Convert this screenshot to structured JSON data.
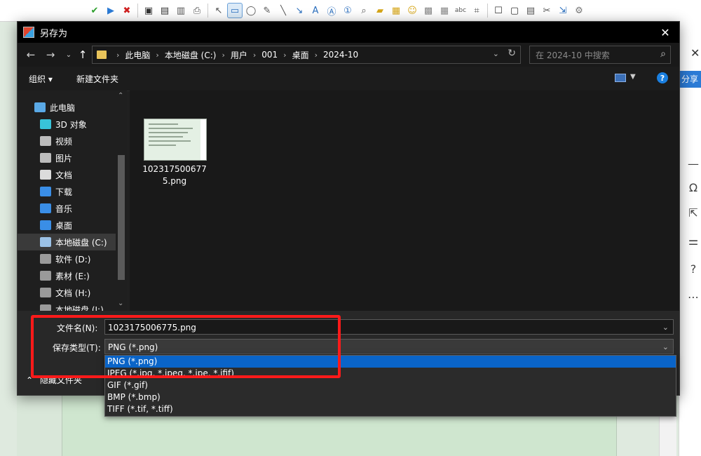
{
  "toolbar": {
    "tools": [
      {
        "icon": "check-icon",
        "glyph": "✔",
        "color": "#2da02d"
      },
      {
        "icon": "play-icon",
        "glyph": "▶",
        "color": "#2b7bd6"
      },
      {
        "icon": "close-x-icon",
        "glyph": "✖",
        "color": "#d02020"
      },
      {
        "icon": "save-icon",
        "glyph": "▣",
        "color": "#333333"
      },
      {
        "icon": "save-as-icon",
        "glyph": "▤",
        "color": "#333333"
      },
      {
        "icon": "clipboard-icon",
        "glyph": "▥",
        "color": "#555555"
      },
      {
        "icon": "print-icon",
        "glyph": "⎙",
        "color": "#555555"
      },
      {
        "icon": "pointer-icon",
        "glyph": "↖",
        "color": "#555555"
      },
      {
        "icon": "rectangle-icon",
        "glyph": "▭",
        "color": "#2b6fbe"
      },
      {
        "icon": "ellipse-icon",
        "glyph": "◯",
        "color": "#555555"
      },
      {
        "icon": "pen-icon",
        "glyph": "✎",
        "color": "#555555"
      },
      {
        "icon": "line-icon",
        "glyph": "╲",
        "color": "#555555"
      },
      {
        "icon": "arrow-icon",
        "glyph": "↘",
        "color": "#2b6fbe"
      },
      {
        "icon": "text-icon",
        "glyph": "A",
        "color": "#2b6fbe"
      },
      {
        "icon": "textbox-icon",
        "glyph": "Ⓐ",
        "color": "#2b6fbe"
      },
      {
        "icon": "counter-icon",
        "glyph": "①",
        "color": "#2b6fbe"
      },
      {
        "icon": "magnifier-icon",
        "glyph": "⌕",
        "color": "#555555"
      },
      {
        "icon": "highlighter-icon",
        "glyph": "▰",
        "color": "#d6a619"
      },
      {
        "icon": "image-icon",
        "glyph": "▦",
        "color": "#d6a619"
      },
      {
        "icon": "emoji-icon",
        "glyph": "☺",
        "color": "#d6a619"
      },
      {
        "icon": "blur-icon",
        "glyph": "▩",
        "color": "#888888"
      },
      {
        "icon": "pixelate-icon",
        "glyph": "▦",
        "color": "#888888"
      },
      {
        "icon": "spellcheck-icon",
        "glyph": "abc",
        "color": "#555555"
      },
      {
        "icon": "crop-icon",
        "glyph": "⌗",
        "color": "#555555"
      },
      {
        "icon": "border-icon",
        "glyph": "☐",
        "color": "#333333"
      },
      {
        "icon": "frame-icon",
        "glyph": "▢",
        "color": "#333333"
      },
      {
        "icon": "shadow-icon",
        "glyph": "▤",
        "color": "#555555"
      },
      {
        "icon": "tools-icon",
        "glyph": "✂",
        "color": "#555555"
      },
      {
        "icon": "export-icon",
        "glyph": "⇲",
        "color": "#2b6fbe"
      },
      {
        "icon": "settings-icon",
        "glyph": "⚙",
        "color": "#777777"
      }
    ]
  },
  "background_app": {
    "share_label": "分享"
  },
  "dialog": {
    "title": "另存为",
    "breadcrumbs": [
      "此电脑",
      "本地磁盘 (C:)",
      "用户",
      "001",
      "桌面",
      "2024-10"
    ],
    "search_placeholder": "在 2024-10 中搜索",
    "organize_label": "组织 ▾",
    "new_folder_label": "新建文件夹",
    "nav_items": [
      {
        "label": "此电脑",
        "icon": "computer-icon",
        "color": "#5aa9e6",
        "indent": 0
      },
      {
        "label": "3D 对象",
        "icon": "cube-icon",
        "color": "#38c3d8",
        "indent": 1
      },
      {
        "label": "视频",
        "icon": "video-icon",
        "color": "#bcbcbc",
        "indent": 1
      },
      {
        "label": "图片",
        "icon": "picture-icon",
        "color": "#bcbcbc",
        "indent": 1
      },
      {
        "label": "文档",
        "icon": "document-icon",
        "color": "#dcdcdc",
        "indent": 1
      },
      {
        "label": "下载",
        "icon": "download-icon",
        "color": "#3a8ee6",
        "indent": 1
      },
      {
        "label": "音乐",
        "icon": "music-icon",
        "color": "#3a8ee6",
        "indent": 1
      },
      {
        "label": "桌面",
        "icon": "desktop-icon",
        "color": "#3a8ee6",
        "indent": 1
      },
      {
        "label": "本地磁盘 (C:)",
        "icon": "drive-c-icon",
        "color": "#9bc1e6",
        "indent": 1,
        "selected": true
      },
      {
        "label": "软件 (D:)",
        "icon": "drive-icon",
        "color": "#9a9a9a",
        "indent": 1
      },
      {
        "label": "素材 (E:)",
        "icon": "drive-icon",
        "color": "#9a9a9a",
        "indent": 1
      },
      {
        "label": "文档 (H:)",
        "icon": "drive-icon",
        "color": "#9a9a9a",
        "indent": 1
      },
      {
        "label": "本地磁盘 (J:)",
        "icon": "drive-icon",
        "color": "#9a9a9a",
        "indent": 1
      }
    ],
    "files": [
      {
        "name": "1023175006775.png"
      }
    ],
    "filename_label": "文件名(N):",
    "filename_value": "1023175006775.png",
    "filetype_label": "保存类型(T):",
    "filetype_value": "PNG (*.png)",
    "filetype_options": [
      "PNG (*.png)",
      "JPEG (*.jpg, *.jpeg, *.jpe, *.jfif)",
      "GIF (*.gif)",
      "BMP (*.bmp)",
      "TIFF (*.tif, *.tiff)"
    ],
    "selected_option": 0,
    "hide_folders_label": "隐藏文件夹"
  },
  "colors": {
    "highlight": "#ff1a1a",
    "selection": "#0a64c8",
    "accent": "#1a7fe0"
  }
}
